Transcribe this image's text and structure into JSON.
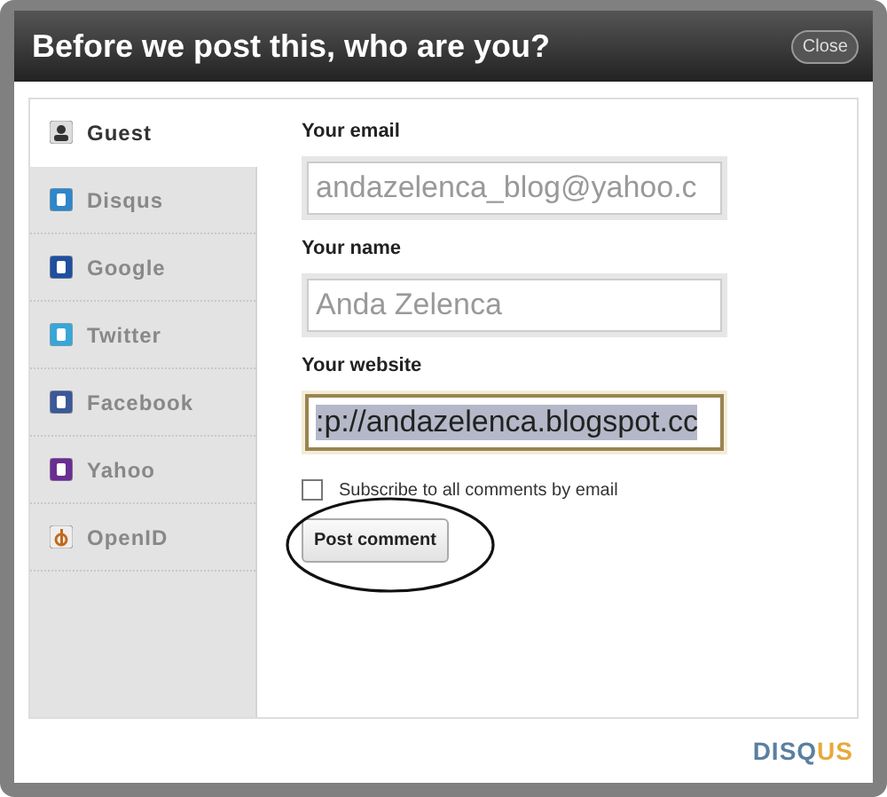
{
  "window": {
    "title": "Before we post this, who are you?",
    "close_button": "Close"
  },
  "sidebar": {
    "items": [
      {
        "label": "Guest",
        "selected": true
      },
      {
        "label": "Disqus",
        "selected": false
      },
      {
        "label": "Google",
        "selected": false
      },
      {
        "label": "Twitter",
        "selected": false
      },
      {
        "label": "Facebook",
        "selected": false
      },
      {
        "label": "Yahoo",
        "selected": false
      },
      {
        "label": "OpenID",
        "selected": false
      }
    ]
  },
  "form": {
    "fields": [
      {
        "label": "Your email",
        "value": "andazelenca_blog@yahoo.c",
        "focused": false
      },
      {
        "label": "Your name",
        "value": "Anda Zelenca",
        "focused": false
      },
      {
        "label": "Your website",
        "value": ":p://andazelenca.blogspot.cc",
        "focused": true
      }
    ],
    "subscribe": {
      "label": "Subscribe to all comments by email",
      "checked": false
    },
    "submit": "Post comment"
  },
  "logo": {
    "parts": [
      {
        "text": "DISQ",
        "color": "#5a7fa0"
      },
      {
        "text": "US",
        "color": "#e8a93a"
      }
    ]
  }
}
